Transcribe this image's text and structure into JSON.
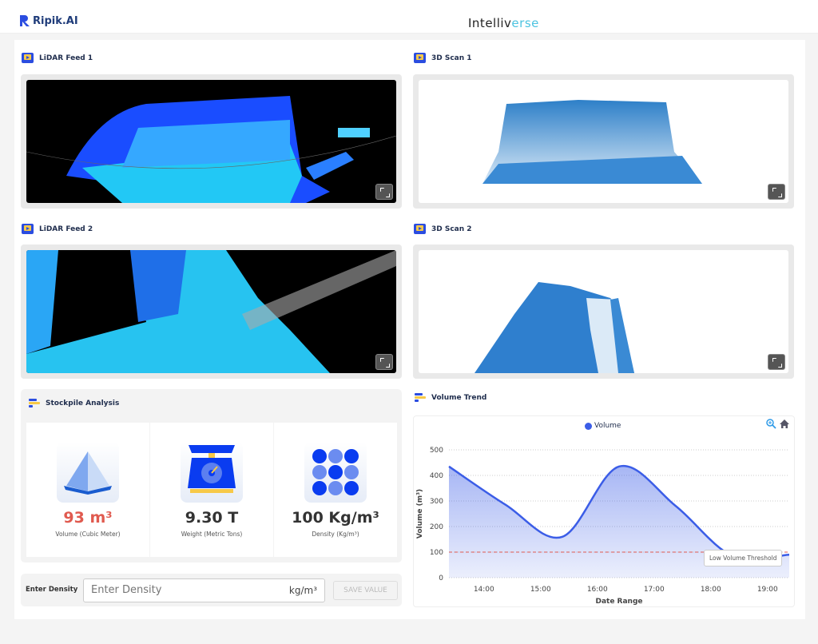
{
  "header": {
    "logo_text": "Ripik.AI",
    "brand_prefix": "Int",
    "brand_mid": "elliv",
    "brand_suffix": "erse"
  },
  "panels": {
    "lidar1": {
      "title": "LiDAR Feed 1"
    },
    "scan1": {
      "title": "3D Scan 1"
    },
    "lidar2": {
      "title": "LiDAR Feed 2"
    },
    "scan2": {
      "title": "3D Scan 2"
    }
  },
  "stockpile": {
    "title": "Stockpile Analysis",
    "metrics": [
      {
        "value": "93 m³",
        "label": "Volume (Cubic Meter)",
        "color": "#e05a4f",
        "icon": "pyramid-icon"
      },
      {
        "value": "9.30 T",
        "label": "Weight (Metric Tons)",
        "color": "#333333",
        "icon": "scale-icon"
      },
      {
        "value": "100 Kg/m³",
        "label": "Density (Kg/m³)",
        "color": "#333333",
        "icon": "particles-icon"
      }
    ]
  },
  "density_form": {
    "label": "Enter Density",
    "placeholder": "Enter Density",
    "value": "",
    "unit": "kg/m³",
    "save_label": "SAVE VALUE"
  },
  "volume_trend": {
    "title": "Volume Trend"
  },
  "chart_data": {
    "type": "area",
    "title": "",
    "legend": [
      "Volume"
    ],
    "legend_placement": "top-center",
    "xlabel": "Date Range",
    "ylabel": "Volume (m³)",
    "x_ticks": [
      "14:00",
      "15:00",
      "16:00",
      "17:00",
      "18:00",
      "19:00"
    ],
    "y_ticks": [
      0,
      100,
      200,
      300,
      400,
      500
    ],
    "ylim": [
      0,
      500
    ],
    "xlim": [
      "13:23",
      "19:23"
    ],
    "grid": "horizontal dotted",
    "series": [
      {
        "name": "Volume",
        "color": "#3b5de7",
        "x": [
          "13:23",
          "14:23",
          "15:23",
          "16:23",
          "17:23",
          "18:23",
          "19:23"
        ],
        "values": [
          435,
          285,
          160,
          435,
          280,
          85,
          90
        ]
      }
    ],
    "threshold": {
      "value": 100,
      "label": "Low Volume Threshold",
      "color": "#e05a4f"
    }
  }
}
